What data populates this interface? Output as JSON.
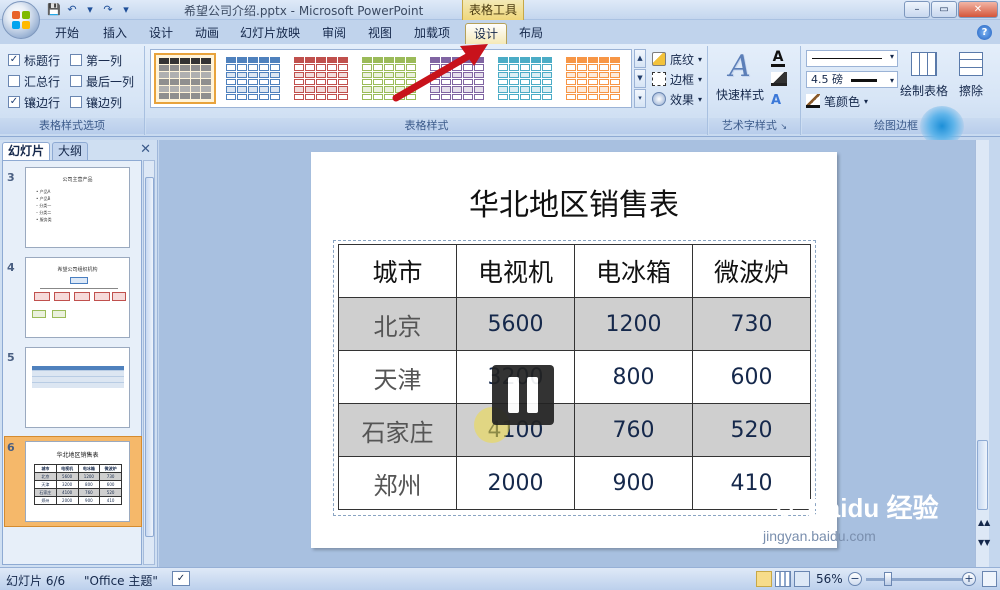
{
  "window": {
    "title": "希望公司介绍.pptx - Microsoft PowerPoint",
    "context_title": "表格工具",
    "controls": [
      "–",
      "▭",
      "✕"
    ]
  },
  "tabs": [
    {
      "label": "开始"
    },
    {
      "label": "插入"
    },
    {
      "label": "设计"
    },
    {
      "label": "动画"
    },
    {
      "label": "幻灯片放映"
    },
    {
      "label": "审阅"
    },
    {
      "label": "视图"
    },
    {
      "label": "加载项"
    },
    {
      "label": "设计",
      "active": true
    },
    {
      "label": "布局"
    }
  ],
  "ribbon": {
    "options": {
      "label": "表格样式选项",
      "checks": [
        {
          "label": "标题行",
          "checked": true
        },
        {
          "label": "第一列",
          "checked": false
        },
        {
          "label": "汇总行",
          "checked": false
        },
        {
          "label": "最后一列",
          "checked": false
        },
        {
          "label": "镶边行",
          "checked": true
        },
        {
          "label": "镶边列",
          "checked": false
        }
      ]
    },
    "styles": {
      "label": "表格样式",
      "swatches": [
        "#5a5a5a",
        "#4f81bd",
        "#c0504d",
        "#9bbb59",
        "#8064a2",
        "#4bacc6",
        "#f79646"
      ],
      "shading": "底纹",
      "border": "边框",
      "effects": "效果"
    },
    "wordart": {
      "label": "艺术字样式",
      "quick": "快速样式"
    },
    "draw": {
      "label": "绘图边框",
      "weight": "4.5 磅",
      "pen_color": "笔颜色",
      "draw_table": "绘制表格",
      "eraser": "擦除"
    }
  },
  "panel": {
    "tab_slides": "幻灯片",
    "tab_outline": "大纲",
    "slides": [
      {
        "num": "3",
        "title": "公司主营产品",
        "bullets": [
          "• 产品A",
          "• 产品B",
          "   – 分类一",
          "   – 分类二",
          "• 服务类"
        ]
      },
      {
        "num": "4",
        "title": "希望公司组织机构"
      },
      {
        "num": "5"
      },
      {
        "num": "6",
        "title": "华北地区销售表"
      }
    ]
  },
  "slide": {
    "title": "华北地区销售表",
    "table": {
      "header": [
        "城市",
        "电视机",
        "电冰箱",
        "微波炉"
      ],
      "rows": [
        [
          "北京",
          "5600",
          "1200",
          "730"
        ],
        [
          "天津",
          "3200",
          "800",
          "600"
        ],
        [
          "石家庄",
          "4100",
          "760",
          "520"
        ],
        [
          "郑州",
          "2000",
          "900",
          "410"
        ]
      ]
    }
  },
  "status": {
    "slide_info": "幻灯片 6/6",
    "theme": "\"Office 主题\"",
    "zoom": "56%"
  },
  "watermark": {
    "brand": "Baidu 经验",
    "url": "jingyan.baidu.com"
  }
}
